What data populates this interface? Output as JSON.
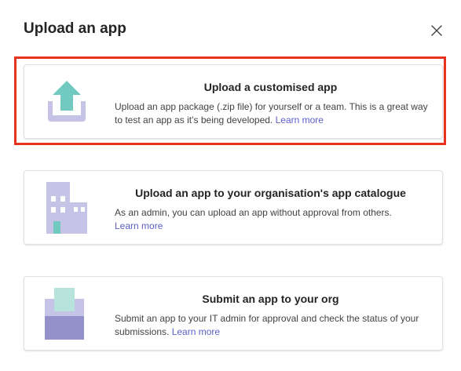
{
  "dialog": {
    "title": "Upload an app",
    "close_label": "Close"
  },
  "options": [
    {
      "title": "Upload a customised app",
      "description": "Upload an app package (.zip file) for yourself or a team. This is a great way to test an app as it’s being developed.",
      "link": "Learn more",
      "icon": "upload-tray-icon",
      "highlighted": true
    },
    {
      "title": "Upload an app to your organisation's app catalogue",
      "description": "As an admin, you can upload an app without approval from others.",
      "link": "Learn more",
      "icon": "building-icon",
      "highlighted": false
    },
    {
      "title": "Submit an app to your org",
      "description": "Submit an app to your IT admin for approval and check the status of your submissions.",
      "link": "Learn more",
      "icon": "inbox-submit-icon",
      "highlighted": false
    }
  ],
  "colors": {
    "highlight_border": "#e8321e",
    "link": "#5b5fc7",
    "icon_lavender": "#c5c3e6",
    "icon_purple": "#9490c9",
    "icon_teal": "#71c9c0"
  }
}
